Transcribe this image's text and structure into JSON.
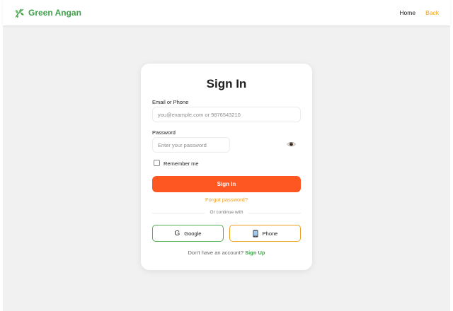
{
  "navbar": {
    "brand": "Green Angan",
    "links": {
      "home": "Home",
      "back": "Back"
    }
  },
  "form": {
    "title": "Sign In",
    "email_label": "Email or Phone",
    "email_placeholder": "you@example.com or 9876543210",
    "password_label": "Password",
    "password_placeholder": "Enter your password",
    "remember_label": "Remember me",
    "submit_label": "Sign In",
    "forgot_label": "Forgot password?",
    "divider_text": "Or continue with",
    "google_label": "Google",
    "google_glyph": "G",
    "phone_label": "Phone",
    "signup_prompt": "Don't have an account?",
    "signup_label": "Sign Up"
  },
  "icons": {
    "brand": "leaf-icon",
    "password_toggle": "eye-icon",
    "google": "google-g-icon",
    "phone": "mobile-phone-icon"
  },
  "colors": {
    "brand_green": "#3ba34a",
    "accent_orange": "#ff5722",
    "link_amber": "#f0a020"
  }
}
